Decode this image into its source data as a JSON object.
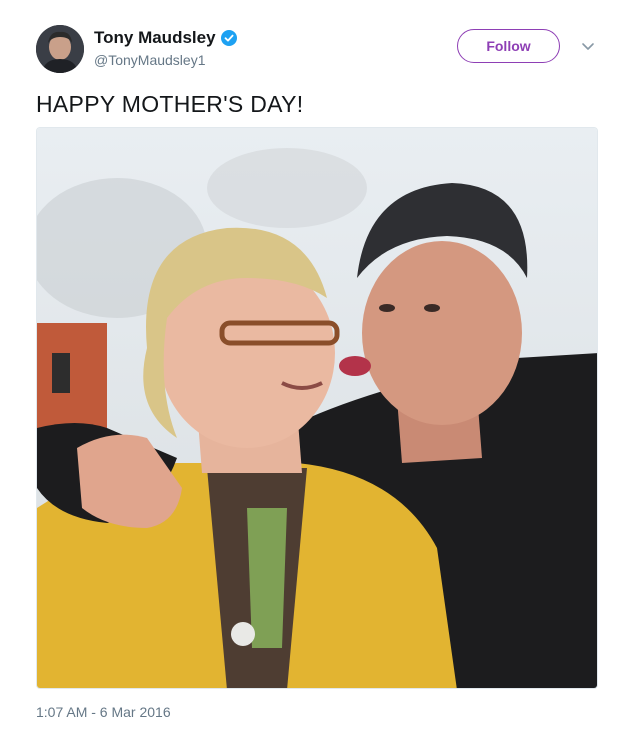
{
  "author": {
    "display_name": "Tony Maudsley",
    "handle": "@TonyMaudsley1",
    "verified": true,
    "avatar_icon": "user-avatar"
  },
  "follow_button": {
    "label": "Follow",
    "color": "#8e3fb5"
  },
  "more_menu": {
    "icon": "chevron-down-icon"
  },
  "tweet": {
    "text": "HAPPY MOTHER'S DAY!"
  },
  "media": {
    "type": "photo"
  },
  "timestamp": "1:07 AM - 6 Mar 2016",
  "colors": {
    "verified": "#1da1f2",
    "secondary_text": "#657786",
    "primary_text": "#14171a"
  }
}
